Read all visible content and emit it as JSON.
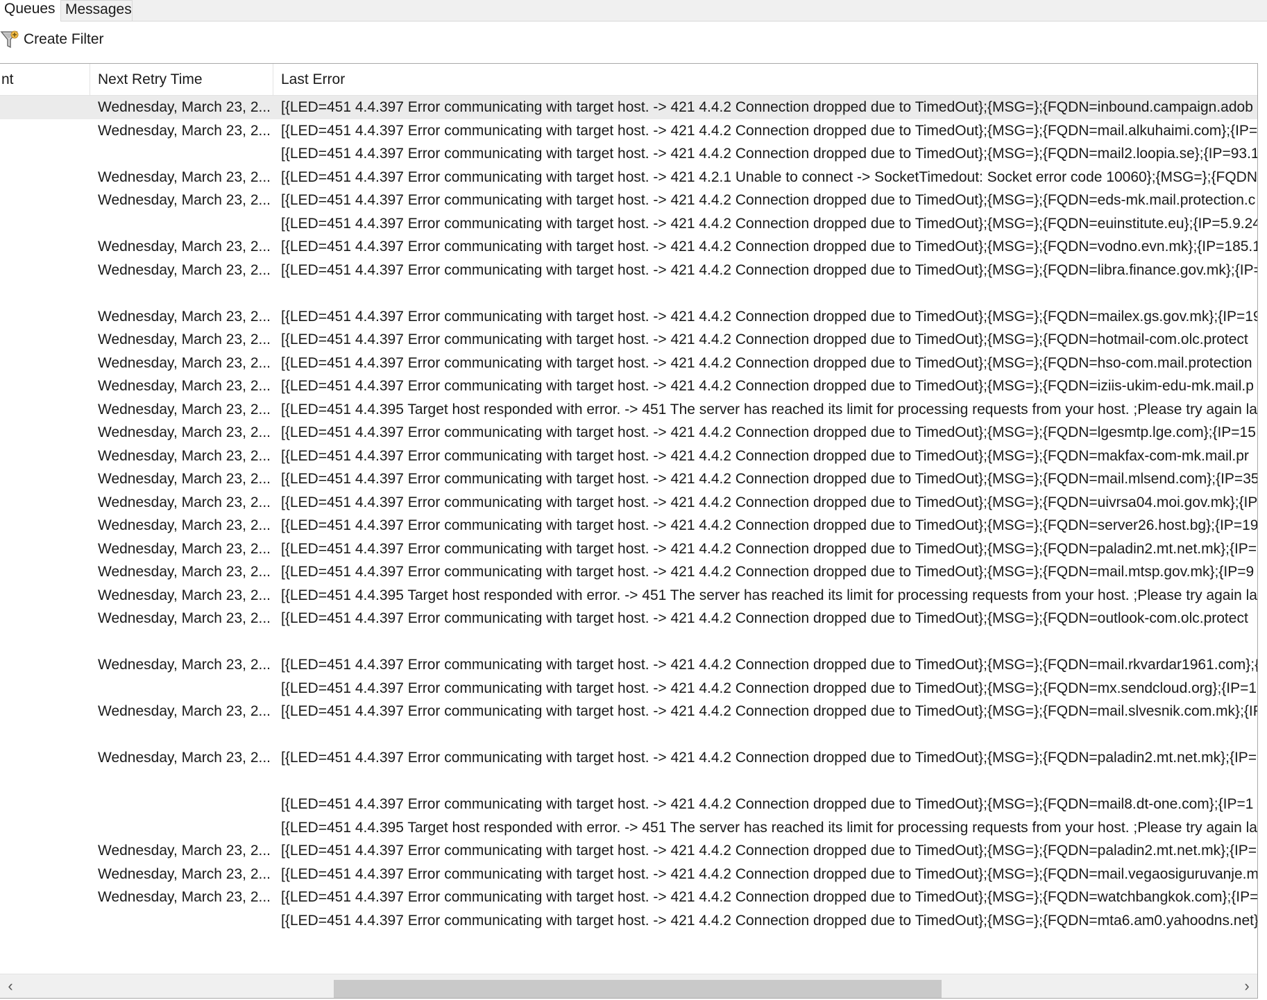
{
  "tabs": [
    "Queues",
    "Messages"
  ],
  "toolbar": {
    "create_filter_label": "Create Filter"
  },
  "table": {
    "columns": [
      "nt",
      "Next Retry Time",
      "Last Error"
    ],
    "rows": [
      [
        "",
        "Wednesday, March 23, 2...",
        "[{LED=451 4.4.397 Error communicating with target host. -> 421 4.4.2 Connection dropped due to TimedOut};{MSG=};{FQDN=inbound.campaign.adob"
      ],
      [
        "",
        "Wednesday, March 23, 2...",
        "[{LED=451 4.4.397 Error communicating with target host. -> 421 4.4.2 Connection dropped due to TimedOut};{MSG=};{FQDN=mail.alkuhaimi.com};{IP="
      ],
      [
        "",
        "",
        "[{LED=451 4.4.397 Error communicating with target host. -> 421 4.4.2 Connection dropped due to TimedOut};{MSG=};{FQDN=mail2.loopia.se};{IP=93.1"
      ],
      [
        "",
        "Wednesday, March 23, 2...",
        "[{LED=451 4.4.397 Error communicating with target host. -> 421 4.2.1 Unable to connect -> SocketTimedout: Socket error code 10060};{MSG=};{FQDN="
      ],
      [
        "",
        "Wednesday, March 23, 2...",
        "[{LED=451 4.4.397 Error communicating with target host. -> 421 4.4.2 Connection dropped due to TimedOut};{MSG=};{FQDN=eds-mk.mail.protection.c"
      ],
      [
        "",
        "",
        "[{LED=451 4.4.397 Error communicating with target host. -> 421 4.4.2 Connection dropped due to TimedOut};{MSG=};{FQDN=euinstitute.eu};{IP=5.9.24"
      ],
      [
        "",
        "Wednesday, March 23, 2...",
        "[{LED=451 4.4.397 Error communicating with target host. -> 421 4.4.2 Connection dropped due to TimedOut};{MSG=};{FQDN=vodno.evn.mk};{IP=185.1"
      ],
      [
        "",
        "Wednesday, March 23, 2...",
        "[{LED=451 4.4.397 Error communicating with target host. -> 421 4.4.2 Connection dropped due to TimedOut};{MSG=};{FQDN=libra.finance.gov.mk};{IP="
      ],
      [
        "",
        "",
        ""
      ],
      [
        "",
        "Wednesday, March 23, 2...",
        "[{LED=451 4.4.397 Error communicating with target host. -> 421 4.4.2 Connection dropped due to TimedOut};{MSG=};{FQDN=mailex.gs.gov.mk};{IP=19"
      ],
      [
        "",
        "Wednesday, March 23, 2...",
        "[{LED=451 4.4.397 Error communicating with target host. -> 421 4.4.2 Connection dropped due to TimedOut};{MSG=};{FQDN=hotmail-com.olc.protect"
      ],
      [
        "",
        "Wednesday, March 23, 2...",
        "[{LED=451 4.4.397 Error communicating with target host. -> 421 4.4.2 Connection dropped due to TimedOut};{MSG=};{FQDN=hso-com.mail.protection"
      ],
      [
        "",
        "Wednesday, March 23, 2...",
        "[{LED=451 4.4.397 Error communicating with target host. -> 421 4.4.2 Connection dropped due to TimedOut};{MSG=};{FQDN=iziis-ukim-edu-mk.mail.p"
      ],
      [
        "",
        "Wednesday, March 23, 2...",
        "[{LED=451 4.4.395 Target host responded with error. -> 451 The server has reached its limit for processing requests from your host. ;Please try again later"
      ],
      [
        "",
        "Wednesday, March 23, 2...",
        "[{LED=451 4.4.397 Error communicating with target host. -> 421 4.4.2 Connection dropped due to TimedOut};{MSG=};{FQDN=lgesmtp.lge.com};{IP=15"
      ],
      [
        "",
        "Wednesday, March 23, 2...",
        "[{LED=451 4.4.397 Error communicating with target host. -> 421 4.4.2 Connection dropped due to TimedOut};{MSG=};{FQDN=makfax-com-mk.mail.pr"
      ],
      [
        "",
        "Wednesday, March 23, 2...",
        "[{LED=451 4.4.397 Error communicating with target host. -> 421 4.4.2 Connection dropped due to TimedOut};{MSG=};{FQDN=mail.mlsend.com};{IP=35"
      ],
      [
        "",
        "Wednesday, March 23, 2...",
        "[{LED=451 4.4.397 Error communicating with target host. -> 421 4.4.2 Connection dropped due to TimedOut};{MSG=};{FQDN=uivrsa04.moi.gov.mk};{IP"
      ],
      [
        "",
        "Wednesday, March 23, 2...",
        "[{LED=451 4.4.397 Error communicating with target host. -> 421 4.4.2 Connection dropped due to TimedOut};{MSG=};{FQDN=server26.host.bg};{IP=193"
      ],
      [
        "",
        "Wednesday, March 23, 2...",
        "[{LED=451 4.4.397 Error communicating with target host. -> 421 4.4.2 Connection dropped due to TimedOut};{MSG=};{FQDN=paladin2.mt.net.mk};{IP="
      ],
      [
        "",
        "Wednesday, March 23, 2...",
        "[{LED=451 4.4.397 Error communicating with target host. -> 421 4.4.2 Connection dropped due to TimedOut};{MSG=};{FQDN=mail.mtsp.gov.mk};{IP=9"
      ],
      [
        "",
        "Wednesday, March 23, 2...",
        "[{LED=451 4.4.395 Target host responded with error. -> 451 The server has reached its limit for processing requests from your host. ;Please try again later"
      ],
      [
        "",
        "Wednesday, March 23, 2...",
        "[{LED=451 4.4.397 Error communicating with target host. -> 421 4.4.2 Connection dropped due to TimedOut};{MSG=};{FQDN=outlook-com.olc.protect"
      ],
      [
        "",
        "",
        ""
      ],
      [
        "",
        "Wednesday, March 23, 2...",
        "[{LED=451 4.4.397 Error communicating with target host. -> 421 4.4.2 Connection dropped due to TimedOut};{MSG=};{FQDN=mail.rkvardar1961.com};{"
      ],
      [
        "",
        "",
        "[{LED=451 4.4.397 Error communicating with target host. -> 421 4.4.2 Connection dropped due to TimedOut};{MSG=};{FQDN=mx.sendcloud.org};{IP=1"
      ],
      [
        "",
        "Wednesday, March 23, 2...",
        "[{LED=451 4.4.397 Error communicating with target host. -> 421 4.4.2 Connection dropped due to TimedOut};{MSG=};{FQDN=mail.slvesnik.com.mk};{IP"
      ],
      [
        "",
        "",
        ""
      ],
      [
        "",
        "Wednesday, March 23, 2...",
        "[{LED=451 4.4.397 Error communicating with target host. -> 421 4.4.2 Connection dropped due to TimedOut};{MSG=};{FQDN=paladin2.mt.net.mk};{IP="
      ],
      [
        "",
        "",
        ""
      ],
      [
        "",
        "",
        "[{LED=451 4.4.397 Error communicating with target host. -> 421 4.4.2 Connection dropped due to TimedOut};{MSG=};{FQDN=mail8.dt-one.com};{IP=1"
      ],
      [
        "",
        "",
        "[{LED=451 4.4.395 Target host responded with error. -> 451 The server has reached its limit for processing requests from your host. ;Please try again later"
      ],
      [
        "",
        "Wednesday, March 23, 2...",
        "[{LED=451 4.4.397 Error communicating with target host. -> 421 4.4.2 Connection dropped due to TimedOut};{MSG=};{FQDN=paladin2.mt.net.mk};{IP="
      ],
      [
        "",
        "Wednesday, March 23, 2...",
        "[{LED=451 4.4.397 Error communicating with target host. -> 421 4.4.2 Connection dropped due to TimedOut};{MSG=};{FQDN=mail.vegaosiguruvanje.m"
      ],
      [
        "",
        "Wednesday, March 23, 2...",
        "[{LED=451 4.4.397 Error communicating with target host. -> 421 4.4.2 Connection dropped due to TimedOut};{MSG=};{FQDN=watchbangkok.com};{IP="
      ],
      [
        "",
        "",
        "[{LED=451 4.4.397 Error communicating with target host. -> 421 4.4.2 Connection dropped due to TimedOut};{MSG=};{FQDN=mta6.am0.yahoodns.net}"
      ]
    ],
    "selected_row": 0
  },
  "scrollbar": {
    "left_arrow": "‹",
    "right_arrow": "›",
    "position": 0.5
  },
  "icons": {
    "create_filter": "funnel-filter-icon"
  }
}
